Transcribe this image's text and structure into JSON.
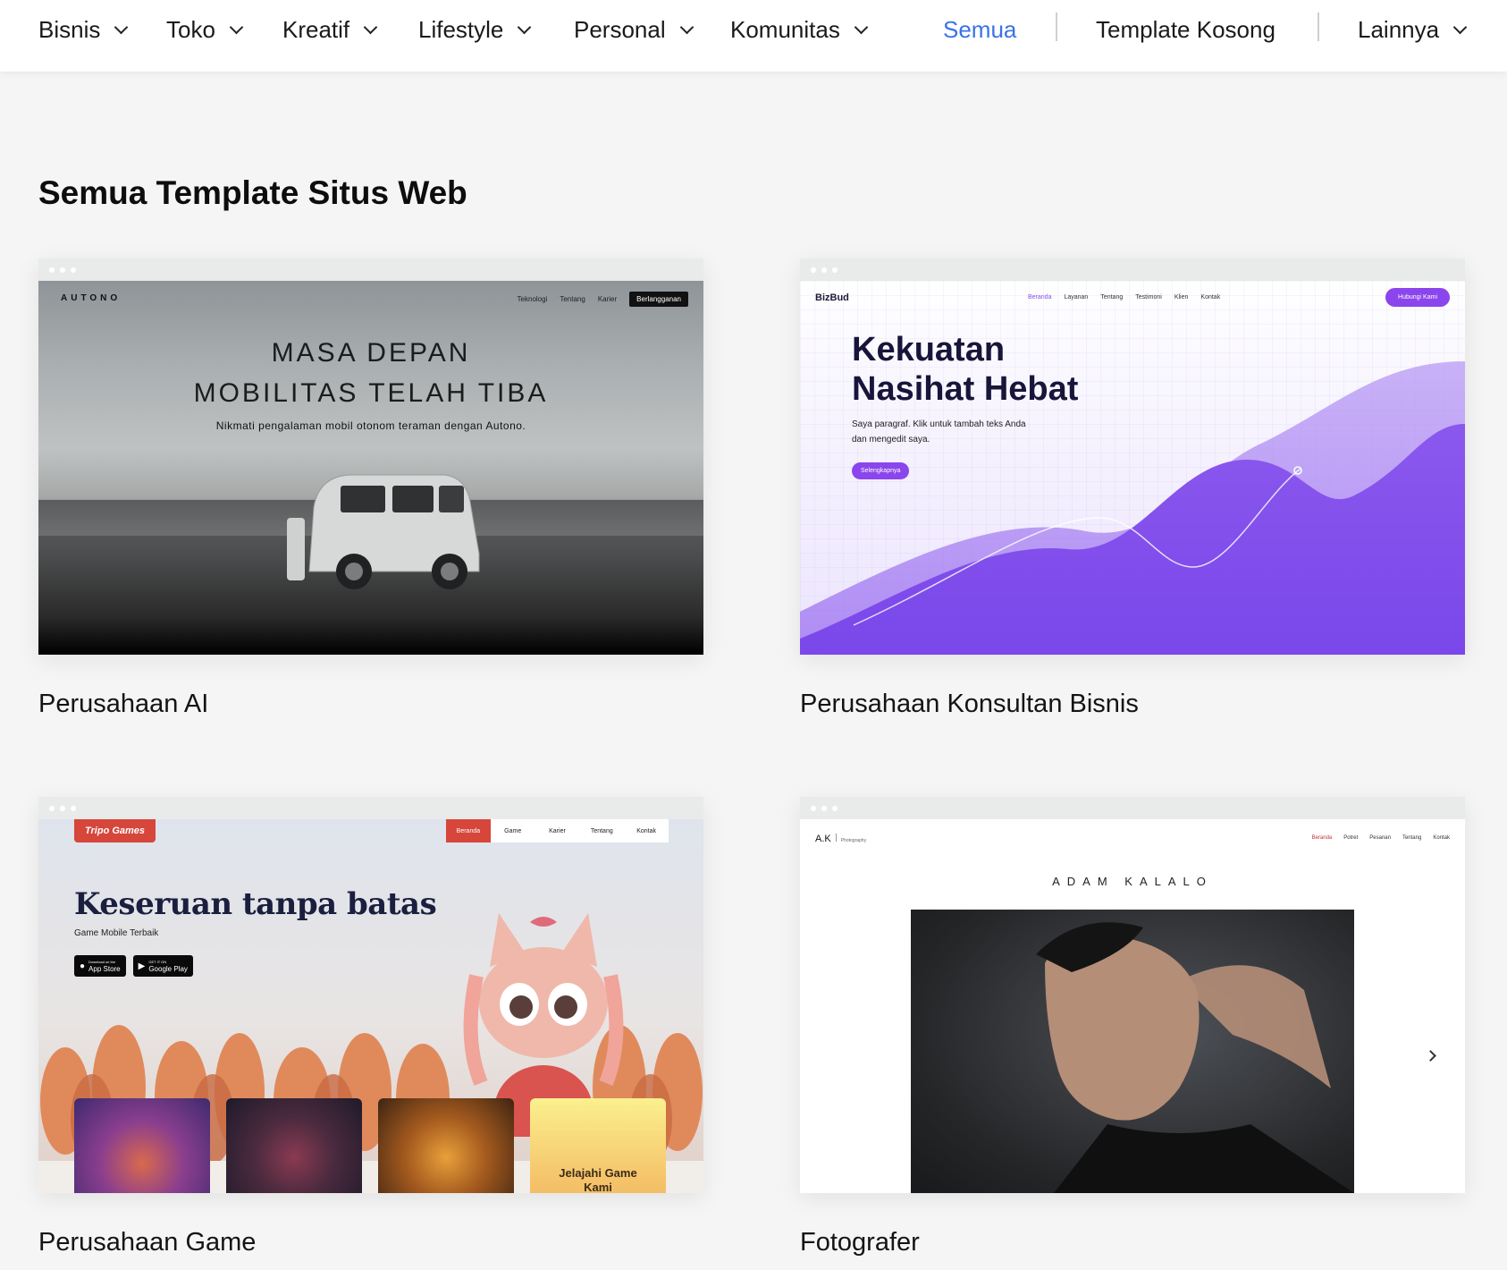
{
  "nav": {
    "items": [
      {
        "label": "Bisnis"
      },
      {
        "label": "Toko"
      },
      {
        "label": "Kreatif"
      },
      {
        "label": "Lifestyle"
      },
      {
        "label": "Personal"
      },
      {
        "label": "Komunitas"
      }
    ],
    "all_label": "Semua",
    "blank_label": "Template Kosong",
    "more_label": "Lainnya",
    "active_color": "#3a73e8"
  },
  "page_title": "Semua Template Situs Web",
  "templates": [
    {
      "caption": "Perusahaan AI",
      "preview": {
        "logo": "AUTONO",
        "nav": [
          "Teknologi",
          "Tentang",
          "Karier",
          "Berlangganan"
        ],
        "headline_1": "MASA DEPAN",
        "headline_2": "MOBILITAS TELAH TIBA",
        "subtext": "Nikmati pengalaman mobil otonom teraman dengan Autono."
      }
    },
    {
      "caption": "Perusahaan Konsultan Bisnis",
      "preview": {
        "logo": "BizBud",
        "nav": [
          "Beranda",
          "Layanan",
          "Tentang",
          "Testimoni",
          "Klien",
          "Kontak"
        ],
        "cta": "Hubungi Kami",
        "headline_1": "Kekuatan",
        "headline_2": "Nasihat Hebat",
        "paragraph_1": "Saya paragraf. Klik untuk tambah teks Anda",
        "paragraph_2": "dan mengedit saya.",
        "button": "Selengkapnya",
        "accent_color": "#8b45ec"
      }
    },
    {
      "caption": "Perusahaan Game",
      "preview": {
        "logo": "Tripo Games",
        "nav": [
          "Beranda",
          "Game",
          "Karier",
          "Tentang",
          "Kontak"
        ],
        "headline": "Keseruan tanpa batas",
        "subtext": "Game Mobile Terbaik",
        "app_store_small": "Download on the",
        "app_store": "App Store",
        "google_play_small": "GET IT ON",
        "google_play": "Google Play",
        "explore_1": "Jelajahi Game",
        "explore_2": "Kami",
        "explore_arrow": "↓",
        "accent_color": "#d6463a"
      }
    },
    {
      "caption": "Fotografer",
      "preview": {
        "logo": "A.K",
        "tagline": "Photography",
        "nav": [
          "Beranda",
          "Potret",
          "Pesanan",
          "Tentang",
          "Kontak"
        ],
        "name": "ADAM KALALO"
      }
    }
  ]
}
